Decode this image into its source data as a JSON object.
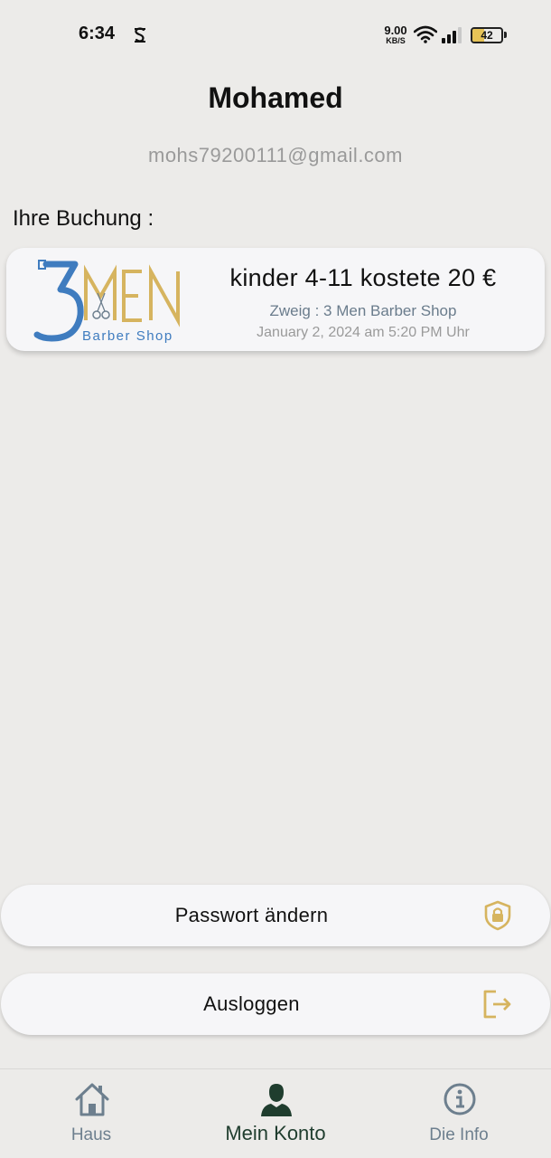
{
  "status_bar": {
    "time": "6:34",
    "net_speed": "9.00",
    "net_unit": "KB/S",
    "battery_level": "42",
    "battery_fraction": 0.42,
    "icons": [
      "s-notification-icon",
      "wifi-icon",
      "signal-icon",
      "battery-icon"
    ]
  },
  "profile": {
    "name": "Mohamed",
    "email": "mohs79200111@gmail.com"
  },
  "bookings": {
    "title": "Ihre Buchung :",
    "items": [
      {
        "logo_brand": "3 MEN",
        "logo_subtitle": "Barber Shop",
        "service": "kinder 4-11 kostete 20 €",
        "branch": "Zweig : 3 Men Barber Shop",
        "datetime": "January 2, 2024 am 5:20 PM Uhr"
      }
    ]
  },
  "actions": {
    "change_password": {
      "label": "Passwort ändern",
      "icon": "shield-lock-icon"
    },
    "logout": {
      "label": "Ausloggen",
      "icon": "logout-icon"
    }
  },
  "nav": {
    "items": [
      {
        "label": "Haus",
        "icon": "home-icon",
        "active": false
      },
      {
        "label": "Mein Konto",
        "icon": "person-icon",
        "active": true
      },
      {
        "label": "Die Info",
        "icon": "info-icon",
        "active": false
      }
    ]
  },
  "colors": {
    "background": "#ecebe9",
    "card": "#f6f6f8",
    "accent_gold": "#d6b45f",
    "logo_blue": "#3f7cbf",
    "nav_active": "#1f3d2e",
    "nav_inactive": "#6d7f8e"
  }
}
